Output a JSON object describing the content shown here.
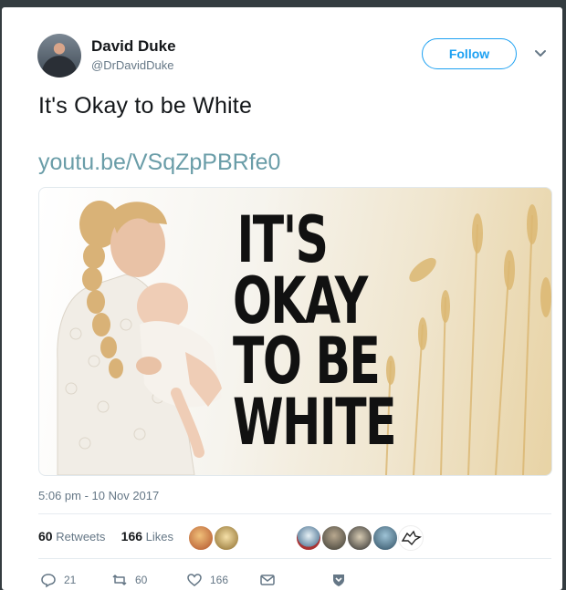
{
  "tweet": {
    "author_name": "David Duke",
    "author_handle": "@DrDavidDuke",
    "follow_label": "Follow",
    "text": "It's Okay to be White",
    "link": "youtu.be/VSqZpPBRfe0",
    "media_text": [
      "IT'S",
      "OKAY",
      "TO BE",
      "WHITE"
    ],
    "timestamp": "5:06 pm - 10 Nov 2017",
    "retweets_count": "60",
    "retweets_label": "Retweets",
    "likes_count": "166",
    "likes_label": "Likes",
    "reply_count": "21",
    "retweet_action_count": "60",
    "like_action_count": "166"
  },
  "colors": {
    "accent": "#1da1f2",
    "link": "#6a9da8",
    "secondary_text": "#657786",
    "primary_text": "#14171a"
  },
  "icons": [
    "chevron-down-icon",
    "reply-icon",
    "retweet-icon",
    "heart-icon",
    "message-icon",
    "shield-icon"
  ]
}
